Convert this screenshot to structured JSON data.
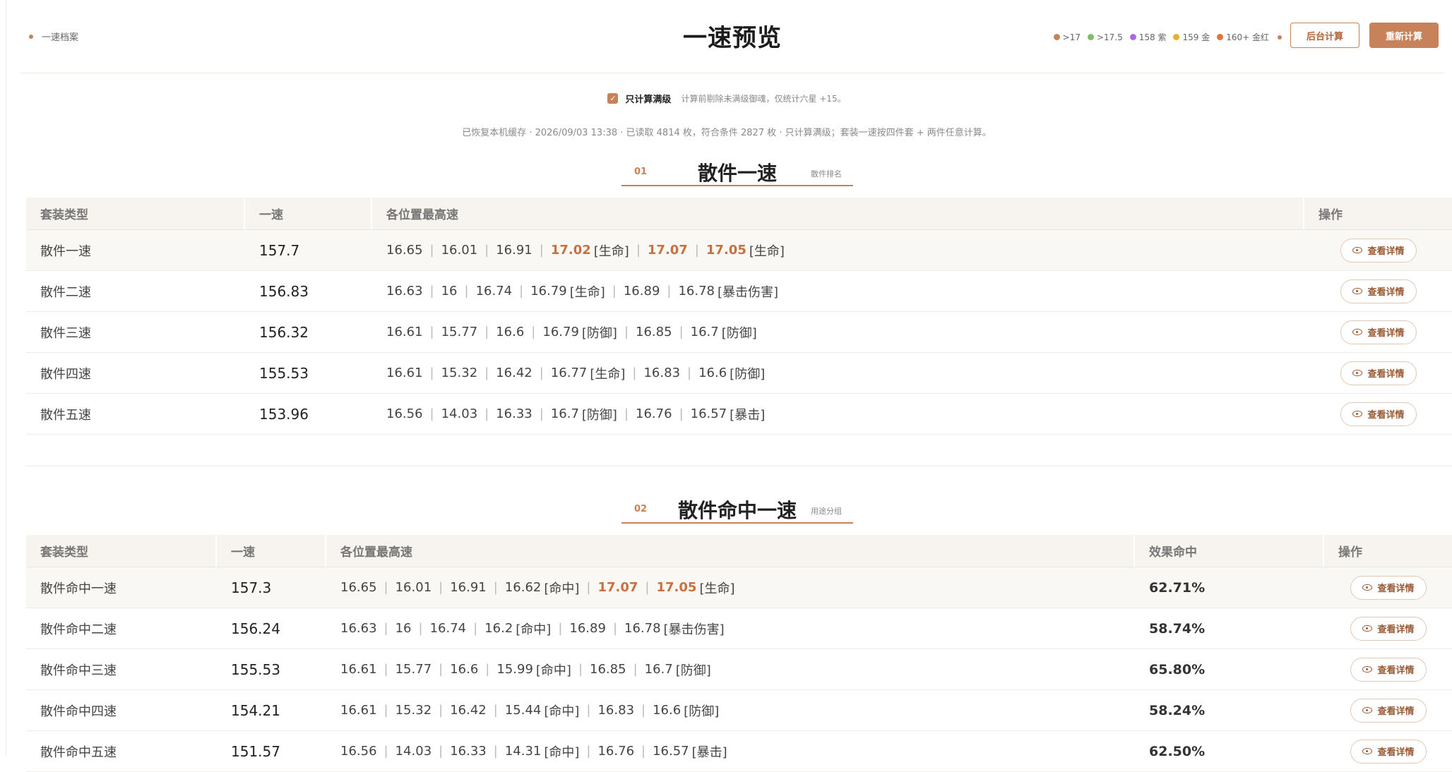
{
  "header": {
    "breadcrumb": "一速档案",
    "title": "一速预览",
    "legend": [
      {
        "label": ">17",
        "color": "#c8825a"
      },
      {
        "label": ">17.5",
        "color": "#7fbf6a"
      },
      {
        "label": "158 紫",
        "color": "#a66be0"
      },
      {
        "label": "159 金",
        "color": "#e5b030"
      },
      {
        "label": "160+ 金红",
        "color": "#e8703c"
      }
    ],
    "btn_background": "后台计算",
    "btn_recalc": "重新计算"
  },
  "options": {
    "checkbox_label": "只计算满级",
    "checkbox_checked": true,
    "hint": "计算前剔除未满级御魂，仅统计六星 +15。",
    "cache_info": "已恢复本机缓存 · 2026/09/03 13:38 · 已读取 4814 枚，符合条件 2827 枚 · 只计算满级；套装一速按四件套 + 两件任意计算。"
  },
  "section1": {
    "num": "01",
    "title": "散件一速",
    "sub": "散件排名",
    "columns": [
      "套装类型",
      "一速",
      "各位置最高速",
      "操作"
    ],
    "detail_label": "查看详情",
    "rows": [
      {
        "type": "散件一速",
        "speed": "157.7",
        "cells": [
          {
            "v": "16.65"
          },
          {
            "v": "16.01"
          },
          {
            "v": "16.91"
          },
          {
            "v": "17.02",
            "hot": true,
            "tag": "[生命]"
          },
          {
            "v": "17.07",
            "hot": true
          },
          {
            "v": "17.05",
            "hot": true,
            "tag": "[生命]"
          }
        ]
      },
      {
        "type": "散件二速",
        "speed": "156.83",
        "cells": [
          {
            "v": "16.63"
          },
          {
            "v": "16"
          },
          {
            "v": "16.74"
          },
          {
            "v": "16.79",
            "tag": "[生命]"
          },
          {
            "v": "16.89"
          },
          {
            "v": "16.78",
            "tag": "[暴击伤害]"
          }
        ]
      },
      {
        "type": "散件三速",
        "speed": "156.32",
        "cells": [
          {
            "v": "16.61"
          },
          {
            "v": "15.77"
          },
          {
            "v": "16.6"
          },
          {
            "v": "16.79",
            "tag": "[防御]"
          },
          {
            "v": "16.85"
          },
          {
            "v": "16.7",
            "tag": "[防御]"
          }
        ]
      },
      {
        "type": "散件四速",
        "speed": "155.53",
        "cells": [
          {
            "v": "16.61"
          },
          {
            "v": "15.32"
          },
          {
            "v": "16.42"
          },
          {
            "v": "16.77",
            "tag": "[生命]"
          },
          {
            "v": "16.83"
          },
          {
            "v": "16.6",
            "tag": "[防御]"
          }
        ]
      },
      {
        "type": "散件五速",
        "speed": "153.96",
        "cells": [
          {
            "v": "16.56"
          },
          {
            "v": "14.03"
          },
          {
            "v": "16.33"
          },
          {
            "v": "16.7",
            "tag": "[防御]"
          },
          {
            "v": "16.76"
          },
          {
            "v": "16.57",
            "tag": "[暴击]"
          }
        ]
      }
    ]
  },
  "section2": {
    "num": "02",
    "title": "散件命中一速",
    "sub": "用途分组",
    "columns": [
      "套装类型",
      "一速",
      "各位置最高速",
      "效果命中",
      "操作"
    ],
    "detail_label": "查看详情",
    "rows": [
      {
        "type": "散件命中一速",
        "speed": "157.3",
        "hit": "62.71%",
        "cells": [
          {
            "v": "16.65"
          },
          {
            "v": "16.01"
          },
          {
            "v": "16.91"
          },
          {
            "v": "16.62",
            "tag": "[命中]"
          },
          {
            "v": "17.07",
            "hot": true
          },
          {
            "v": "17.05",
            "hot": true,
            "tag": "[生命]"
          }
        ]
      },
      {
        "type": "散件命中二速",
        "speed": "156.24",
        "hit": "58.74%",
        "cells": [
          {
            "v": "16.63"
          },
          {
            "v": "16"
          },
          {
            "v": "16.74"
          },
          {
            "v": "16.2",
            "tag": "[命中]"
          },
          {
            "v": "16.89"
          },
          {
            "v": "16.78",
            "tag": "[暴击伤害]"
          }
        ]
      },
      {
        "type": "散件命中三速",
        "speed": "155.53",
        "hit": "65.80%",
        "cells": [
          {
            "v": "16.61"
          },
          {
            "v": "15.77"
          },
          {
            "v": "16.6"
          },
          {
            "v": "15.99",
            "tag": "[命中]"
          },
          {
            "v": "16.85"
          },
          {
            "v": "16.7",
            "tag": "[防御]"
          }
        ]
      },
      {
        "type": "散件命中四速",
        "speed": "154.21",
        "hit": "58.24%",
        "cells": [
          {
            "v": "16.61"
          },
          {
            "v": "15.32"
          },
          {
            "v": "16.42"
          },
          {
            "v": "15.44",
            "tag": "[命中]"
          },
          {
            "v": "16.83"
          },
          {
            "v": "16.6",
            "tag": "[防御]"
          }
        ]
      },
      {
        "type": "散件命中五速",
        "speed": "151.57",
        "hit": "62.50%",
        "cells": [
          {
            "v": "16.56"
          },
          {
            "v": "14.03"
          },
          {
            "v": "16.33"
          },
          {
            "v": "14.31",
            "tag": "[命中]"
          },
          {
            "v": "16.76"
          },
          {
            "v": "16.57",
            "tag": "[暴击]"
          }
        ]
      }
    ]
  }
}
